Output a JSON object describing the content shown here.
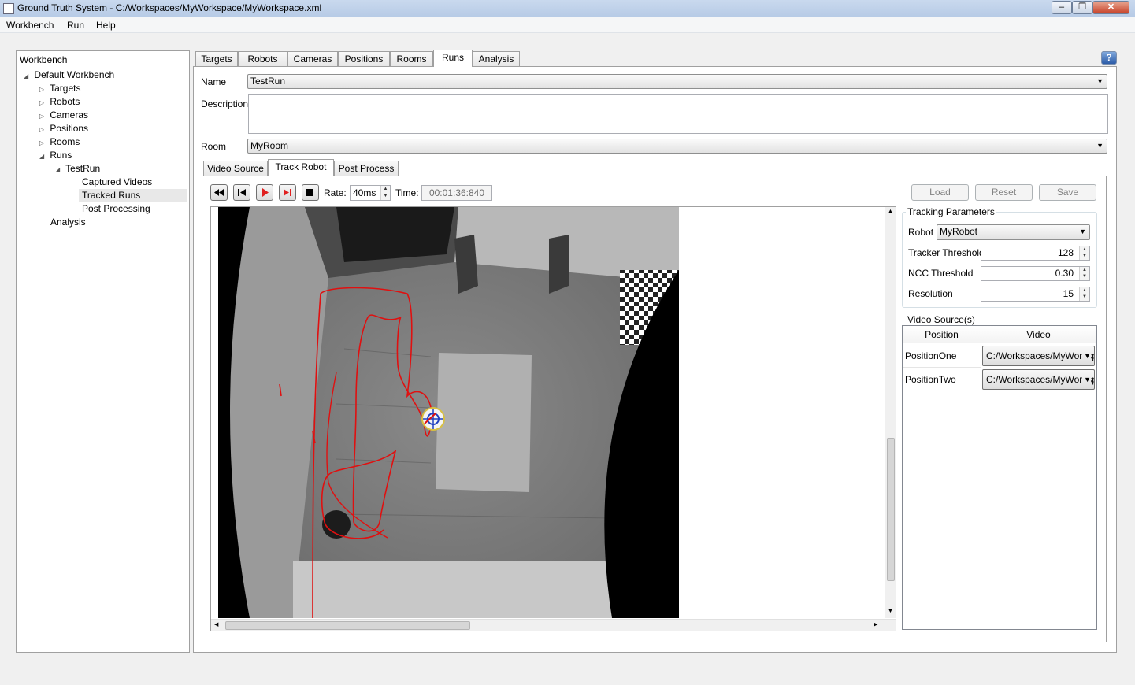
{
  "window": {
    "title": "Ground Truth System - C:/Workspaces/MyWorkspace/MyWorkspace.xml"
  },
  "menu": {
    "workbench": "Workbench",
    "run": "Run",
    "help": "Help"
  },
  "workbench": {
    "header": "Workbench",
    "tree": {
      "root": "Default Workbench",
      "targets": "Targets",
      "robots": "Robots",
      "cameras": "Cameras",
      "positions": "Positions",
      "rooms": "Rooms",
      "runs": "Runs",
      "testrun": "TestRun",
      "captured_videos": "Captured Videos",
      "tracked_runs": "Tracked Runs",
      "post_processing": "Post Processing",
      "analysis": "Analysis"
    }
  },
  "tabs": [
    "Targets",
    "Robots",
    "Cameras",
    "Positions",
    "Rooms",
    "Runs",
    "Analysis"
  ],
  "active_tab": "Runs",
  "run_form": {
    "name_label": "Name",
    "name_value": "TestRun",
    "description_label": "Description",
    "description_value": "",
    "room_label": "Room",
    "room_value": "MyRoom"
  },
  "sub_tabs": [
    "Video Source",
    "Track Robot",
    "Post Process"
  ],
  "active_sub_tab": "Track Robot",
  "transport": {
    "rate_label": "Rate:",
    "rate_value": "40ms",
    "time_label": "Time:",
    "time_value": "00:01:36:840",
    "load": "Load",
    "reset": "Reset",
    "save": "Save"
  },
  "tracking": {
    "group_title": "Tracking Parameters",
    "robot_label": "Robot",
    "robot_value": "MyRobot",
    "tracker_threshold_label": "Tracker Threshold",
    "tracker_threshold_value": "128",
    "ncc_threshold_label": "NCC Threshold",
    "ncc_threshold_value": "0.30",
    "resolution_label": "Resolution",
    "resolution_value": "15"
  },
  "video_sources": {
    "group_title": "Video Source(s)",
    "col_position": "Position",
    "col_video": "Video",
    "rows": [
      {
        "position": "PositionOne",
        "video": "C:/Workspaces/MyWorkspace"
      },
      {
        "position": "PositionTwo",
        "video": "C:/Workspaces/MyWorkspace"
      }
    ]
  },
  "colors": {
    "track": "#e01010",
    "accent": "#3a6fc0"
  }
}
